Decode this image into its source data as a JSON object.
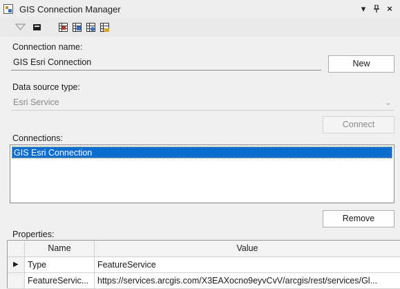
{
  "window": {
    "title": "GIS Connection Manager",
    "controls": {
      "dropdown": "▾",
      "pin": "ᵖ",
      "close": "×"
    }
  },
  "toolbar": {
    "icons": [
      "filter-icon",
      "layer-icon",
      "grid-icon",
      "grid-edit-icon",
      "grid-refresh-icon",
      "grid-add-icon"
    ]
  },
  "connection_name": {
    "label": "Connection name:",
    "value": "GIS Esri Connection",
    "new_button": "New"
  },
  "data_source": {
    "label": "Data source type:",
    "selected": "Esri Service",
    "connect_button": "Connect"
  },
  "connections": {
    "label": "Connections:",
    "items": [
      "GIS Esri Connection"
    ],
    "remove_button": "Remove"
  },
  "properties": {
    "label": "Properties:",
    "columns": [
      "Name",
      "Value"
    ],
    "rows": [
      {
        "name": "Type",
        "value": "FeatureService"
      },
      {
        "name": "FeatureServic...",
        "value": "https://services.arcgis.com/X3EAXocno9eyvCvV/arcgis/rest/services/Gl..."
      }
    ]
  },
  "colors": {
    "selection": "#0a6ed1",
    "background": "#f0f0f0"
  }
}
